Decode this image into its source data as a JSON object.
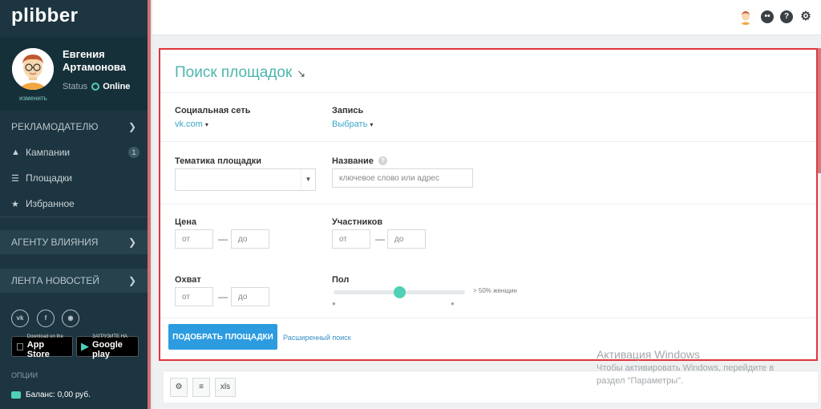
{
  "sidebar": {
    "logo": "plibber",
    "user": {
      "name": "Евгения Артамонова",
      "change_label": "изменить",
      "status_label": "Status",
      "status_value": "Online"
    },
    "advertiser_header": "РЕКЛАМОДАТЕЛЮ",
    "items": [
      {
        "label": "Кампании",
        "icon": "megaphone-icon",
        "badge": "1"
      },
      {
        "label": "Площадки",
        "icon": "list-icon"
      },
      {
        "label": "Избранное",
        "icon": "star-icon"
      }
    ],
    "agent_header": "АГЕНТУ ВЛИЯНИЯ",
    "news_header": "ЛЕНТА НОВОСТЕЙ",
    "app_store": {
      "small": "Download on the",
      "big": "App Store"
    },
    "google_play": {
      "small": "ЗАГРУЗИТЕ НА",
      "big": "Google play"
    },
    "options_label": "ОПЦИИ",
    "balance": "Баланс: 0,00 руб."
  },
  "search": {
    "title": "Поиск площадок",
    "social_network_label": "Социальная сеть",
    "social_network_value": "vk.com",
    "record_label": "Запись",
    "record_value": "Выбрать",
    "topic_label": "Тематика площадки",
    "name_label": "Название",
    "name_placeholder": "ключевое слово или адрес",
    "price_label": "Цена",
    "members_label": "Участников",
    "reach_label": "Охват",
    "gender_label": "Пол",
    "from_placeholder": "от",
    "to_placeholder": "до",
    "gender_value_text": "> 50% женщин",
    "gender_slider_fraction": 0.5,
    "submit_label": "ПОДОБРАТЬ ПЛОЩАДКИ",
    "advanced_label": "Расширенный поиск"
  },
  "toolbar": {
    "xls_label": "xls"
  },
  "watermark": {
    "title": "Активация Windows",
    "line1": "Чтобы активировать Windows, перейдите в",
    "line2": "раздел \"Параметры\"."
  },
  "colors": {
    "sidebar_bg": "#1d3540",
    "accent_teal": "#4db6ac",
    "primary_blue": "#2c9be0",
    "highlight_red": "#e0353b"
  }
}
